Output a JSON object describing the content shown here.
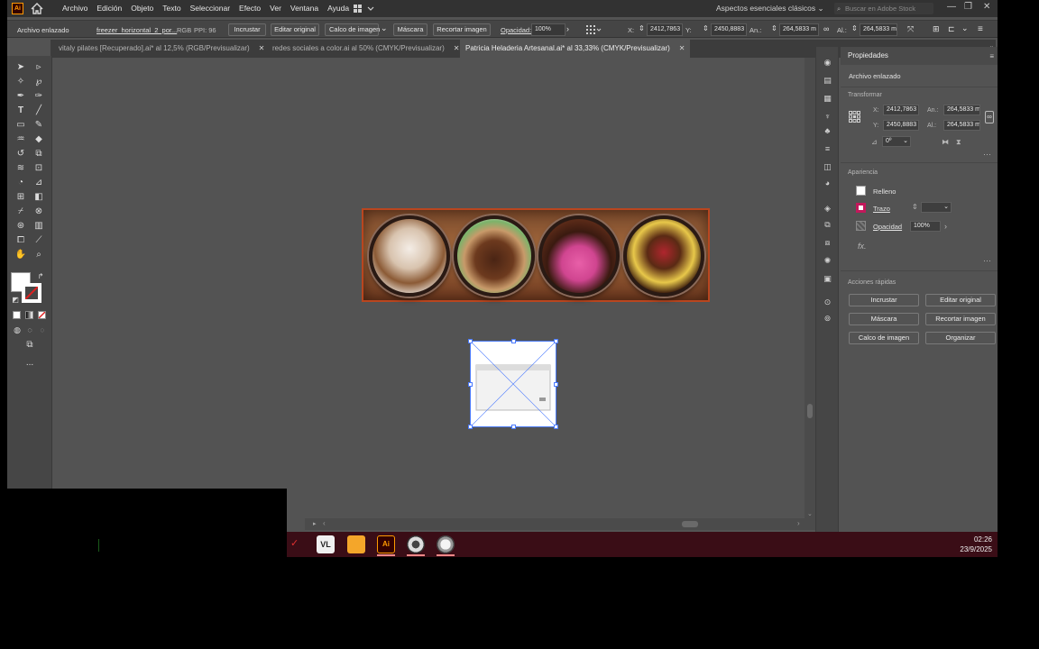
{
  "menubar": {
    "logo": "Ai",
    "items": [
      "Archivo",
      "Edición",
      "Objeto",
      "Texto",
      "Seleccionar",
      "Efecto",
      "Ver",
      "Ventana",
      "Ayuda"
    ],
    "workspace": "Aspectos esenciales clásicos",
    "stock_placeholder": "Buscar en Adobe Stock"
  },
  "control_bar": {
    "linked_file_label": "Archivo enlazado",
    "file_name": "freezer_horizontal_2_por...",
    "color_mode": "RGB",
    "ppi": "PPI: 96",
    "embed": "Incrustar",
    "edit_original": "Editar original",
    "image_trace": "Calco de imagen",
    "mask": "Máscara",
    "crop_image": "Recortar imagen",
    "opacity_label": "Opacidad:",
    "opacity_value": "100%",
    "x_label": "X:",
    "x_value": "2412,7863",
    "y_label": "Y:",
    "y_value": "2450,8883",
    "w_label": "An.:",
    "w_value": "264,5833 m",
    "h_label": "Al.:",
    "h_value": "264,5833 m"
  },
  "tabs": [
    {
      "label": "vitaly pilates [Recuperado].ai* al 12,5% (RGB/Previsualizar)",
      "active": false
    },
    {
      "label": "redes sociales a color.ai al 50% (CMYK/Previsualizar)",
      "active": false
    },
    {
      "label": "Patricia Heladeria Artesanal.ai* al 33,33% (CMYK/Previsualizar)",
      "active": true
    }
  ],
  "panel": {
    "title": "Propiedades",
    "object_type": "Archivo enlazado",
    "transform_section": "Transformar",
    "x_label": "X:",
    "x_value": "2412,7863",
    "y_label": "Y:",
    "y_value": "2450,8883",
    "w_label": "An.:",
    "w_value": "264,5833 m",
    "h_label": "Al.:",
    "h_value": "264,5833 m",
    "angle_value": "0º",
    "appearance_section": "Apariencia",
    "fill_label": "Relleno",
    "stroke_label": "Trazo",
    "opacity_label": "Opacidad",
    "opacity_value": "100%",
    "fx_label": "fx.",
    "quick_actions_section": "Acciones rápidas",
    "buttons": {
      "embed": "Incrustar",
      "edit_original": "Editar original",
      "mask": "Máscara",
      "crop_image": "Recortar imagen",
      "image_trace": "Calco de imagen",
      "arrange": "Organizar"
    }
  },
  "toolbar": {
    "more": "..."
  },
  "taskbar": {
    "time": "02:26",
    "date": "23/9/2025"
  },
  "colors": {
    "app_bg": "#535353",
    "menubar_bg": "#323232",
    "accent_blue": "#4a7aff",
    "banner_border": "#b9461f",
    "taskbar_bg": "#3a0d16",
    "ai_orange": "#ff9a00"
  }
}
